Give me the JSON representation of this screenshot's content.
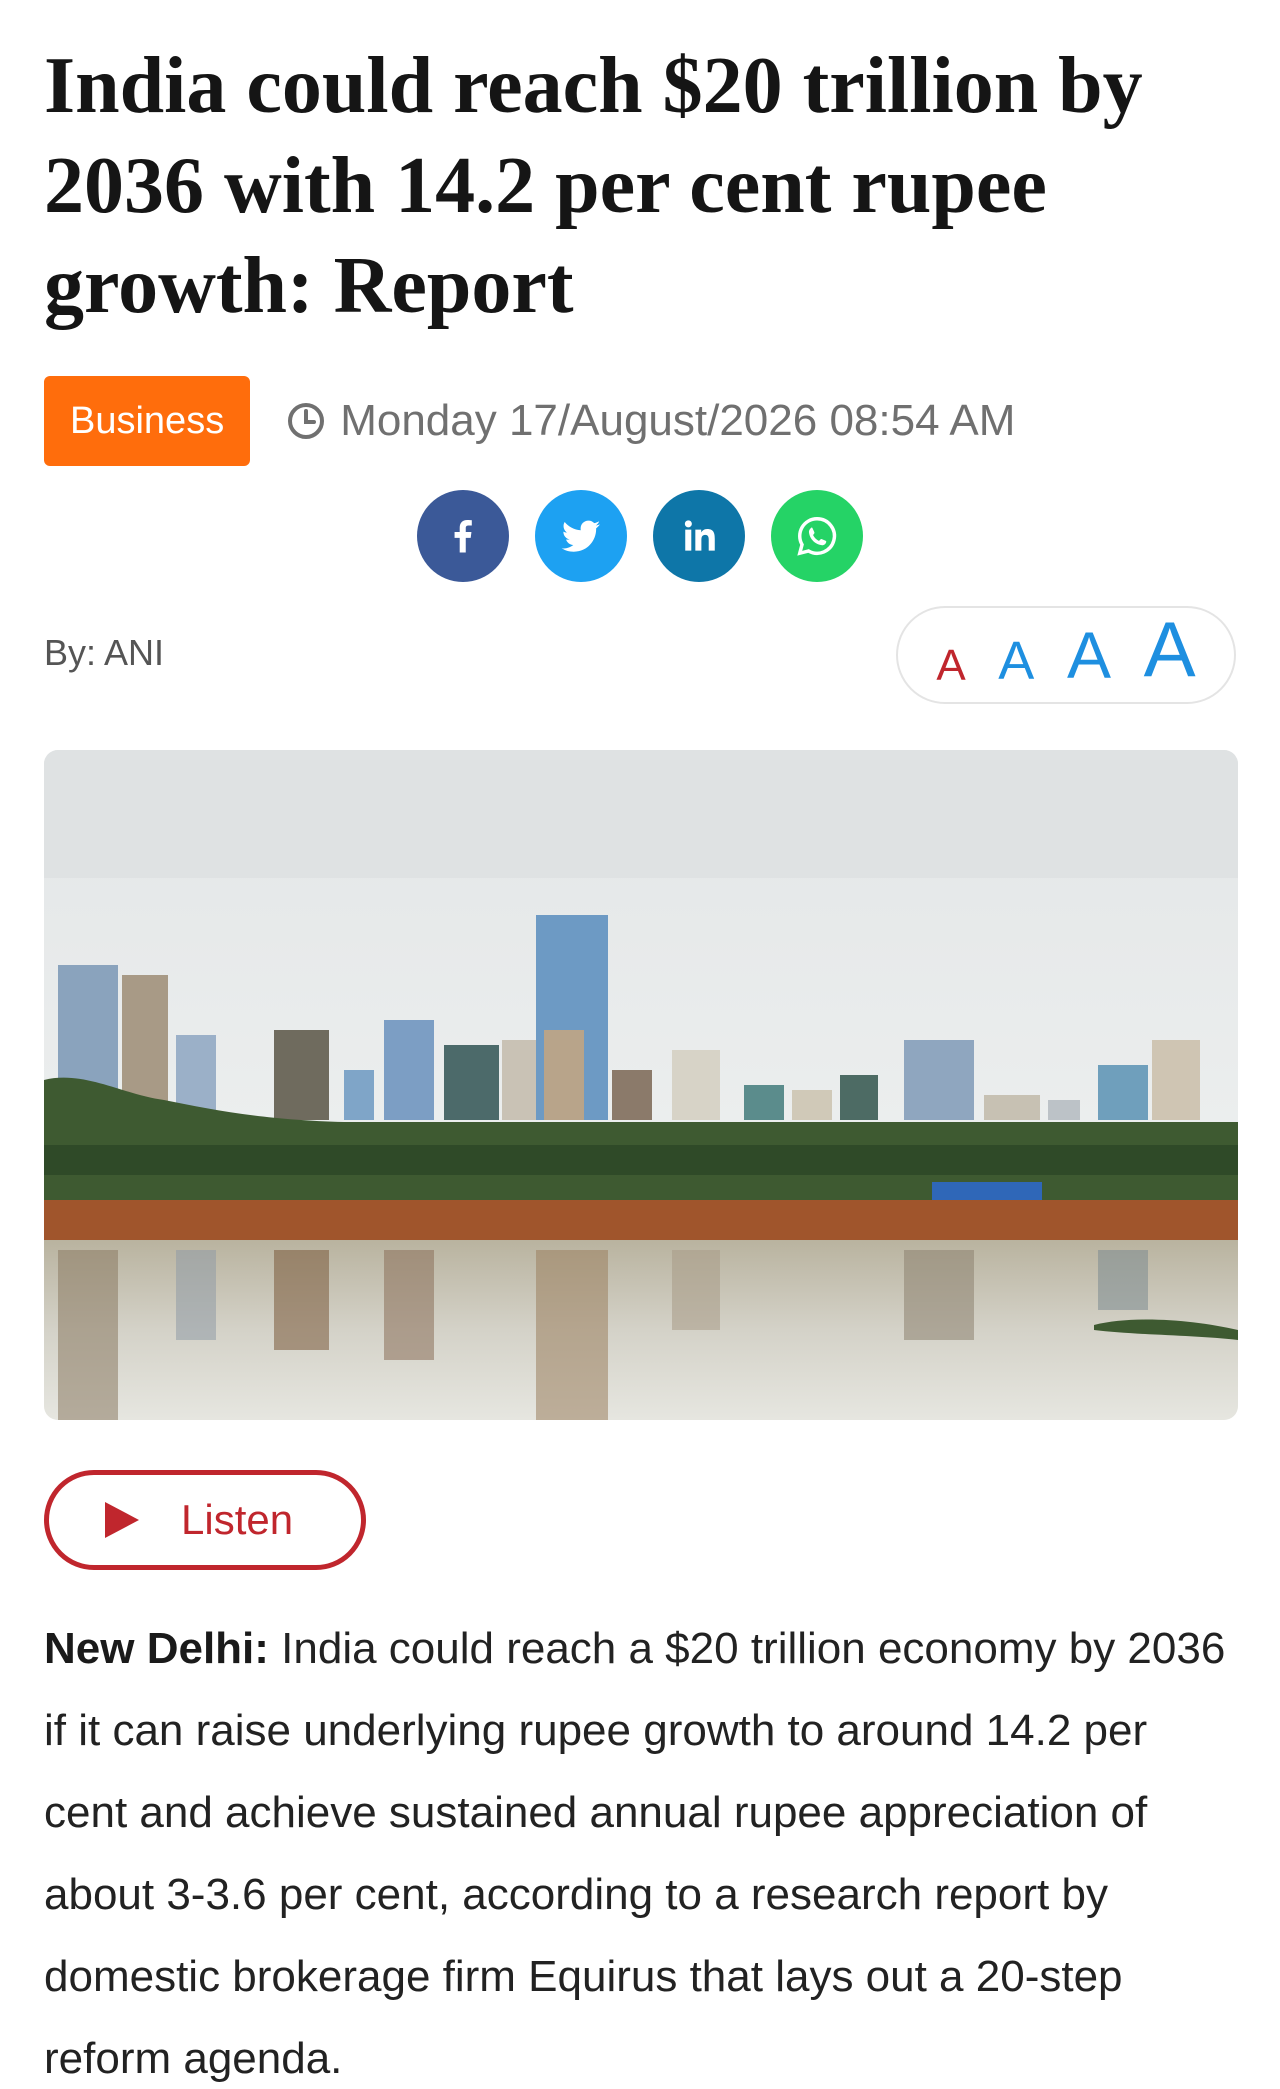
{
  "article": {
    "headline": "India could reach $20 trillion by 2036 with 14.2 per cent rupee growth: Report",
    "category": "Business",
    "datetime": "Monday 17/August/2026 08:54 AM",
    "byline": "By: ANI",
    "dateline": "New Delhi:",
    "body": " India could reach a $20 trillion economy by 2036 if it can raise underlying rupee growth to around 14.2 per cent and achieve sustained annual rupee appreciation of about 3-3.6 per cent, according to a research report by domestic brokerage firm Equirus that lays out a 20-step reform agenda."
  },
  "share": {
    "icons": [
      "facebook-icon",
      "twitter-icon",
      "linkedin-icon",
      "whatsapp-icon"
    ],
    "colors": {
      "facebook": "#3b5998",
      "twitter": "#1da1f2",
      "linkedin": "#0e76a8",
      "whatsapp": "#25d366"
    }
  },
  "font_size_control": {
    "options": [
      "A",
      "A",
      "A",
      "A"
    ]
  },
  "listen": {
    "label": "Listen"
  },
  "colors": {
    "category": "#ff6d0c",
    "accent": "#c0262d",
    "font_option": "#1e8fe0"
  }
}
